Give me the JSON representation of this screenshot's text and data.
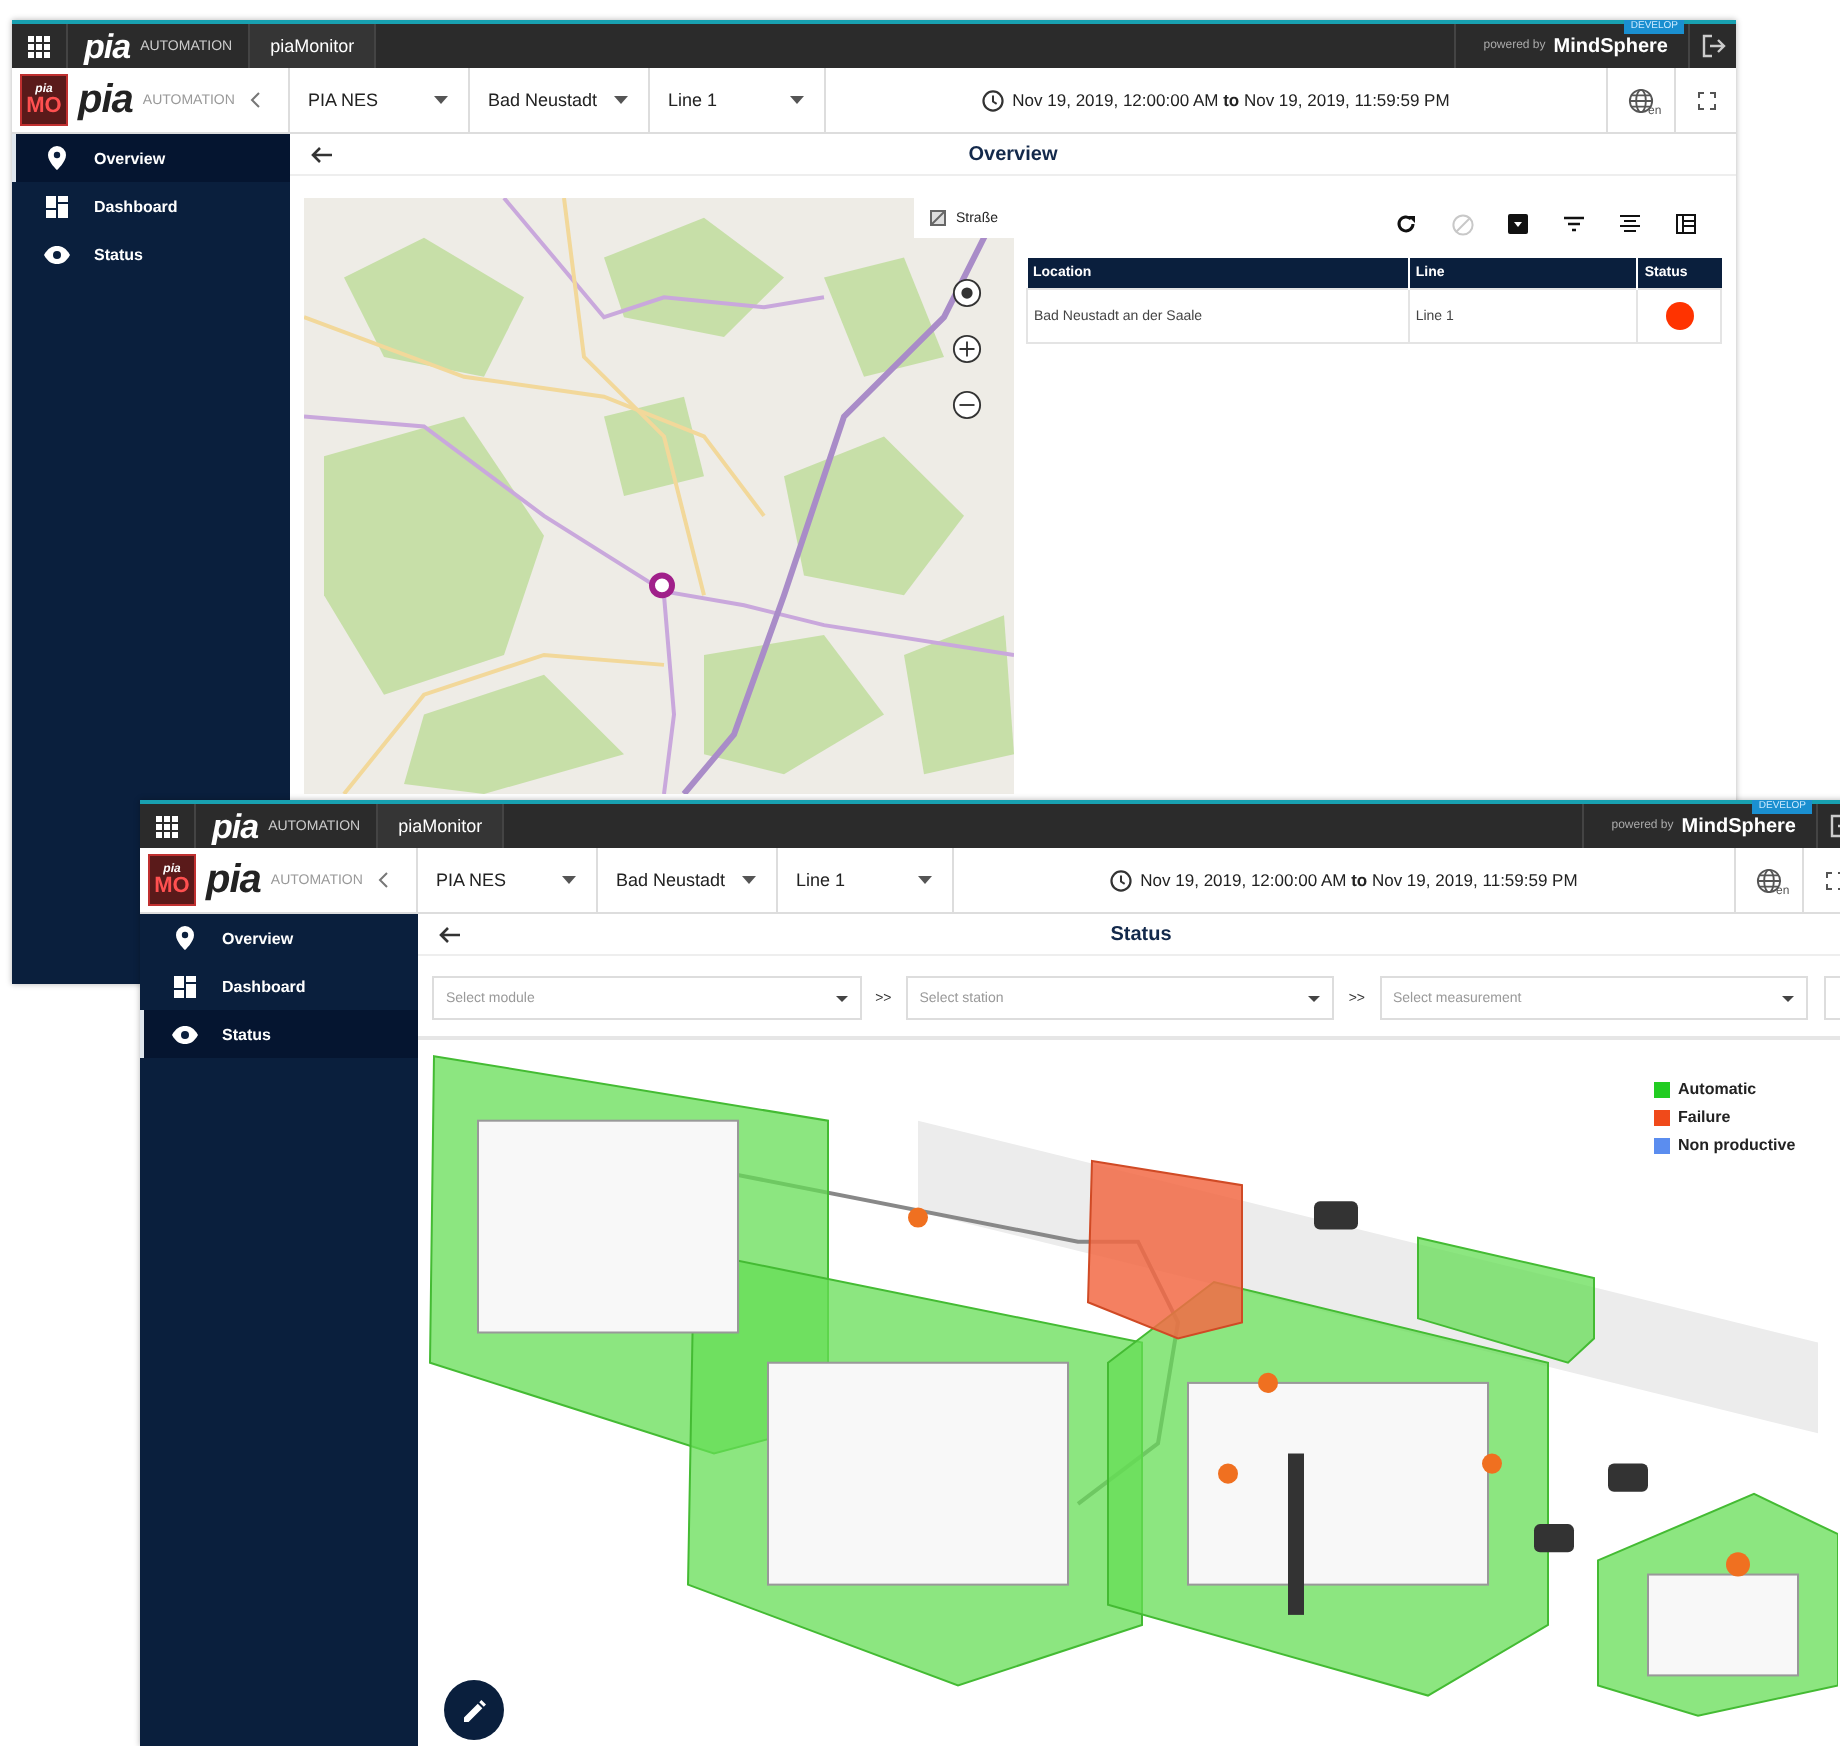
{
  "windows": [
    {
      "kind": "overview",
      "app_bar": {
        "logo": "pia",
        "brand": "AUTOMATION",
        "app_name": "piaMonitor",
        "powered_by": "powered by",
        "platform": "MindSphere",
        "badge": "DEVELOP"
      },
      "header": {
        "badge_top": "pia",
        "badge_main": "MO",
        "logo": "pia",
        "brand": "AUTOMATION",
        "filters": [
          "PIA NES",
          "Bad Neustadt",
          "Line 1"
        ],
        "date_range": "Nov 19, 2019, 12:00:00 AM **to** Nov 19, 2019, 11:59:59 PM",
        "language": "en"
      },
      "sidebar": [
        {
          "label": "Overview",
          "selected": true
        },
        {
          "label": "Dashboard",
          "selected": false
        },
        {
          "label": "Status",
          "selected": false
        }
      ],
      "page_title": "Overview",
      "map": {
        "layer_button": "Straße"
      },
      "toolbar": [
        {
          "kind": "refresh",
          "disabled": false
        },
        {
          "kind": "ban",
          "disabled": true
        },
        {
          "kind": "download",
          "disabled": false
        },
        {
          "kind": "filter",
          "disabled": false
        },
        {
          "kind": "align",
          "disabled": false
        },
        {
          "kind": "columns",
          "disabled": false
        }
      ],
      "table": {
        "columns": [
          "Location",
          "Line",
          "Status"
        ],
        "rows": [
          {
            "location": "Bad Neustadt an der Saale",
            "line": "Line 1",
            "color": "#ff3300"
          }
        ]
      }
    },
    {
      "kind": "status",
      "app_bar": {
        "logo": "pia",
        "brand": "AUTOMATION",
        "app_name": "piaMonitor",
        "powered_by": "powered by",
        "platform": "MindSphere",
        "badge": "DEVELOP"
      },
      "header": {
        "badge_top": "pia",
        "badge_main": "MO",
        "logo": "pia",
        "brand": "AUTOMATION",
        "filters": [
          "PIA NES",
          "Bad Neustadt",
          "Line 1"
        ],
        "date_range": "Nov 19, 2019, 12:00:00 AM **to** Nov 19, 2019, 11:59:59 PM",
        "language": "en"
      },
      "sidebar": [
        {
          "label": "Overview",
          "selected": false
        },
        {
          "label": "Dashboard",
          "selected": false
        },
        {
          "label": "Status",
          "selected": true
        }
      ],
      "page_title": "Status",
      "selects": [
        {
          "placeholder": "Select module"
        },
        {
          "placeholder": "Select station"
        },
        {
          "placeholder": "Select measurement"
        }
      ],
      "separators": [
        ">>",
        ">>"
      ],
      "legend": [
        {
          "label": "Automatic",
          "color": "#22cc22"
        },
        {
          "label": "Failure",
          "color": "#f04a1a"
        },
        {
          "label": "Non productive",
          "color": "#5b8def"
        }
      ]
    }
  ]
}
